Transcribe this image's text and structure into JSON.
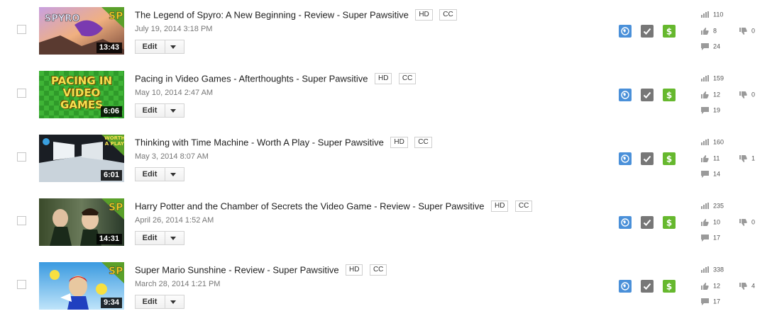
{
  "colors": {
    "globe": "#4a90d9",
    "check": "#777777",
    "dollar": "#66b82e"
  },
  "rows": [
    {
      "title": "The Legend of Spyro: A New Beginning - Review - Super Pawsitive",
      "badges": [
        "HD",
        "CC"
      ],
      "date": "July 19, 2014 3:18 PM",
      "duration": "13:43",
      "edit_label": "Edit",
      "views": "110",
      "likes": "8",
      "dislikes": "0",
      "comments": "24",
      "thumb_text": "SPYRO",
      "thumb_logo": "SP"
    },
    {
      "title": "Pacing in Video Games - Afterthoughts - Super Pawsitive",
      "badges": [
        "HD",
        "CC"
      ],
      "date": "May 10, 2014 2:47 AM",
      "duration": "6:06",
      "edit_label": "Edit",
      "views": "159",
      "likes": "12",
      "dislikes": "0",
      "comments": "19",
      "thumb_text": "PACING IN VIDEO GAMES"
    },
    {
      "title": "Thinking with Time Machine - Worth A Play - Super Pawsitive",
      "badges": [
        "HD",
        "CC"
      ],
      "date": "May 3, 2014 8:07 AM",
      "duration": "6:01",
      "edit_label": "Edit",
      "views": "160",
      "likes": "11",
      "dislikes": "1",
      "comments": "14",
      "thumb_text": "WORTH A PLAY"
    },
    {
      "title": "Harry Potter and the Chamber of Secrets the Video Game - Review - Super Pawsitive",
      "badges": [
        "HD",
        "CC"
      ],
      "date": "April 26, 2014 1:52 AM",
      "duration": "14:31",
      "edit_label": "Edit",
      "views": "235",
      "likes": "10",
      "dislikes": "0",
      "comments": "17",
      "thumb_logo": "SP"
    },
    {
      "title": "Super Mario Sunshine - Review - Super Pawsitive",
      "badges": [
        "HD",
        "CC"
      ],
      "date": "March 28, 2014 1:21 PM",
      "duration": "9:34",
      "edit_label": "Edit",
      "views": "338",
      "likes": "12",
      "dislikes": "4",
      "comments": "17",
      "thumb_logo": "SP"
    }
  ]
}
